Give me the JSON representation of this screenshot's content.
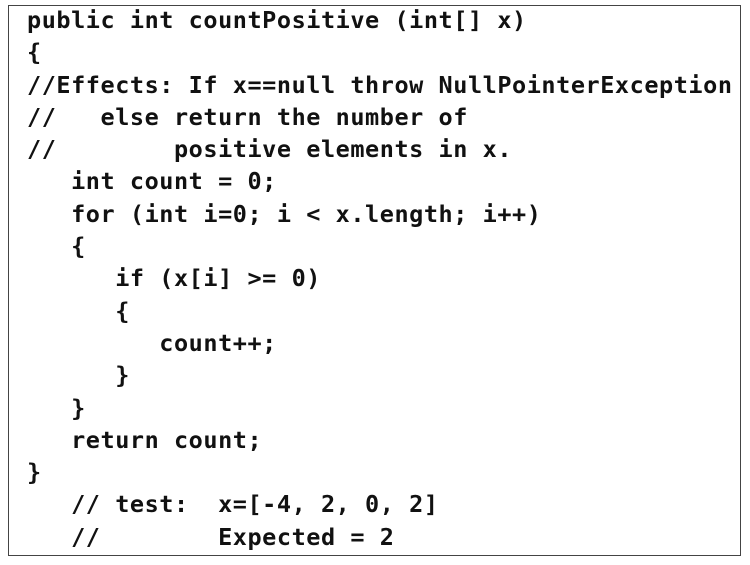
{
  "code": {
    "lines": [
      "public int countPositive (int[] x)",
      "{",
      "//Effects: If x==null throw NullPointerException",
      "//   else return the number of",
      "//        positive elements in x.",
      "   int count = 0;",
      "   for (int i=0; i < x.length; i++)",
      "   {",
      "      if (x[i] >= 0)",
      "      {",
      "         count++;",
      "      }",
      "   }",
      "   return count;",
      "}",
      "   // test:  x=[-4, 2, 0, 2]",
      "   //        Expected = 2"
    ]
  }
}
